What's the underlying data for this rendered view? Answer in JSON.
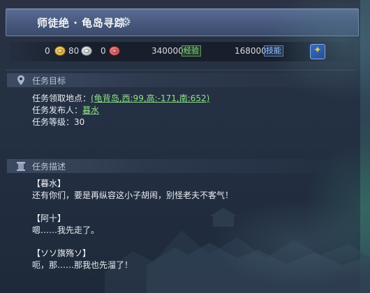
{
  "title": {
    "text": "师徒绝 · 龟岛寻踪",
    "icon": "gear-icon"
  },
  "rewards": {
    "gold": "0",
    "silver": "80",
    "red": "0",
    "exp_value": "340000",
    "exp_label": "经验",
    "skill_value": "168000",
    "skill_label": "技能",
    "skill_icon": "skill-book-icon"
  },
  "objective": {
    "header": "任务目标",
    "location_label": "任务领取地点：",
    "location_value": "(龟背岛,西:99,高:-171,南:652)",
    "giver_label": "任务发布人：",
    "giver_value": "暮水",
    "level_label": "任务等级：",
    "level_value": "30"
  },
  "description": {
    "header": "任务描述",
    "lines": [
      {
        "speaker": "【暮水】",
        "text": "还有你们，要是再纵容这小子胡闹，别怪老夫不客气！"
      },
      {
        "speaker": "【阿十】",
        "text": "嗯……我先走了。"
      },
      {
        "speaker": "【ソソ旗殇ソ】",
        "text": "呃，那……那我也先溜了！"
      }
    ]
  },
  "colors": {
    "accent_green": "#8fe088",
    "accent_blue": "#9fc4ff",
    "title_bar": "#4a5c80"
  }
}
